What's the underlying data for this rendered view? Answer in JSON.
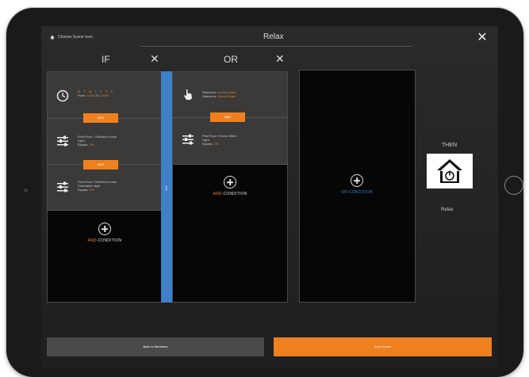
{
  "header": {
    "choose_icon_label": "Choose Scene Icon",
    "scene_title": "Relax"
  },
  "if_column": {
    "title": "IF",
    "conditions": [
      {
        "icon": "clock-icon",
        "days": "M T W T F S S",
        "from_label": "From:",
        "from_value": "18:00",
        "to_label": "To:",
        "to_value": "19:00"
      },
      {
        "icon": "sliders-icon",
        "line1": "First Floor / Children's room",
        "line2": "Light",
        "equals_label": "Equals:",
        "equals_value": "ON"
      },
      {
        "icon": "sliders-icon",
        "line1": "First Floor / Children's room",
        "line2": "Orientation light",
        "equals_label": "Equals:",
        "equals_value": "ON"
      }
    ],
    "and_badge": "AND",
    "add_keyword": "AND",
    "add_suffix": "-CONDITION"
  },
  "or_divider_label": "OR",
  "or_column": {
    "title": "OR",
    "conditions": [
      {
        "icon": "hand-pointer-icon",
        "line1_label": "Started in:",
        "line1_value": "via Schedule",
        "line2_label": "Started in:",
        "line2_value": "Scene Relax"
      },
      {
        "icon": "sliders-icon",
        "line1": "First Floor / Home Office",
        "line2": "Light",
        "equals_label": "Equals:",
        "equals_value": "ON"
      }
    ],
    "and_badge": "AND",
    "add_keyword": "AND",
    "add_suffix": "-CONDITION"
  },
  "or_panel": {
    "add_keyword": "OR",
    "add_suffix": "-CONDITION"
  },
  "then": {
    "label": "THEN",
    "icon": "house-power-icon",
    "scene_name": "Relax"
  },
  "footer": {
    "back_label": "Back to Members",
    "save_label": "Save Scene"
  },
  "colors": {
    "accent": "#f07f1e",
    "divider": "#3e80c9"
  }
}
